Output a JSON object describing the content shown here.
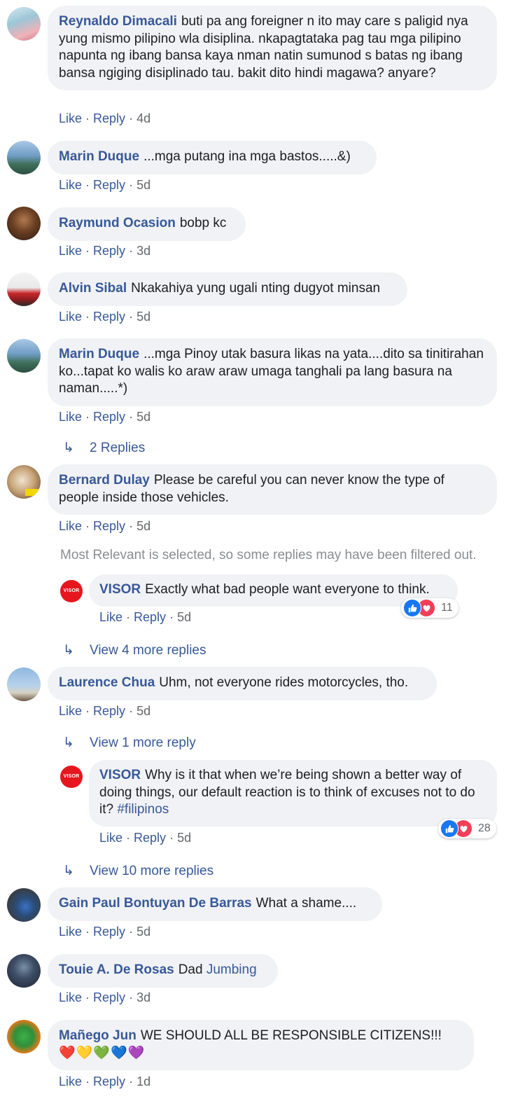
{
  "actions": {
    "like": "Like",
    "reply": "Reply"
  },
  "comments": [
    {
      "name": "Reynaldo Dimacali",
      "text": "buti pa ang foreigner n ito may care s paligid nya yung mismo pilipino wla disiplina. nkapagtataka pag tau mga pilipino napunta ng ibang bansa kaya nman natin sumunod s batas ng ibang bansa ngiging disiplinado tau. bakit dito hindi magawa? anyare?",
      "time": "4d"
    },
    {
      "name": "Marin Duque",
      "text": "...mga putang ina mga bastos.....&)",
      "time": "5d"
    },
    {
      "name": "Raymund Ocasion",
      "text": "bobp kc",
      "time": "3d"
    },
    {
      "name": "Alvin Sibal",
      "text": "Nkakahiya yung ugali nting dugyot minsan",
      "time": "5d"
    },
    {
      "name": "Marin Duque",
      "text": "...mga Pinoy utak basura likas na yata....dito sa tinitirahan ko...tapat ko walis ko araw araw umaga tanghali pa lang basura na naman.....*)",
      "time": "5d"
    },
    {
      "name": "Bernard Dulay",
      "text": "Please be careful you can never know the type of people inside those vehicles.",
      "time": "5d"
    },
    {
      "name": "Laurence Chua",
      "text": "Uhm, not everyone rides motorcycles, tho.",
      "time": "5d"
    },
    {
      "name": "Gain Paul Bontuyan De Barras",
      "text": "What a shame....",
      "time": "5d"
    },
    {
      "name": "Touie A. De Rosas",
      "text": "Dad",
      "mention": "Jumbing",
      "time": "3d"
    },
    {
      "name": "Mañego Jun",
      "text": "WE SHOULD ALL BE RESPONSIBLE CITIZENS!!!",
      "emoji": "❤️💛💚💙💜",
      "time": "1d"
    }
  ],
  "replies": [
    {
      "name": "VISOR",
      "avatar_text": "VISOR",
      "text": "Exactly what bad people want everyone to think.",
      "time": "5d",
      "reactions": "11"
    },
    {
      "name": "VISOR",
      "avatar_text": "VISOR",
      "text": "Why is it that when we’re being shown a better way of doing things, our default reaction is to think of excuses not to do it?",
      "hashtag": "#filipinos",
      "time": "5d",
      "reactions": "28"
    }
  ],
  "more_links": {
    "two_replies": "2 Replies",
    "view4": "View 4 more replies",
    "view1": "View 1 more reply",
    "view10": "View 10 more replies"
  },
  "filter_note": "Most Relevant is selected, so some replies may have been filtered out.",
  "colors": {
    "link": "#385898",
    "bubble": "#f0f2f5",
    "meta": "#65676b",
    "visor_red": "#e6161f"
  }
}
